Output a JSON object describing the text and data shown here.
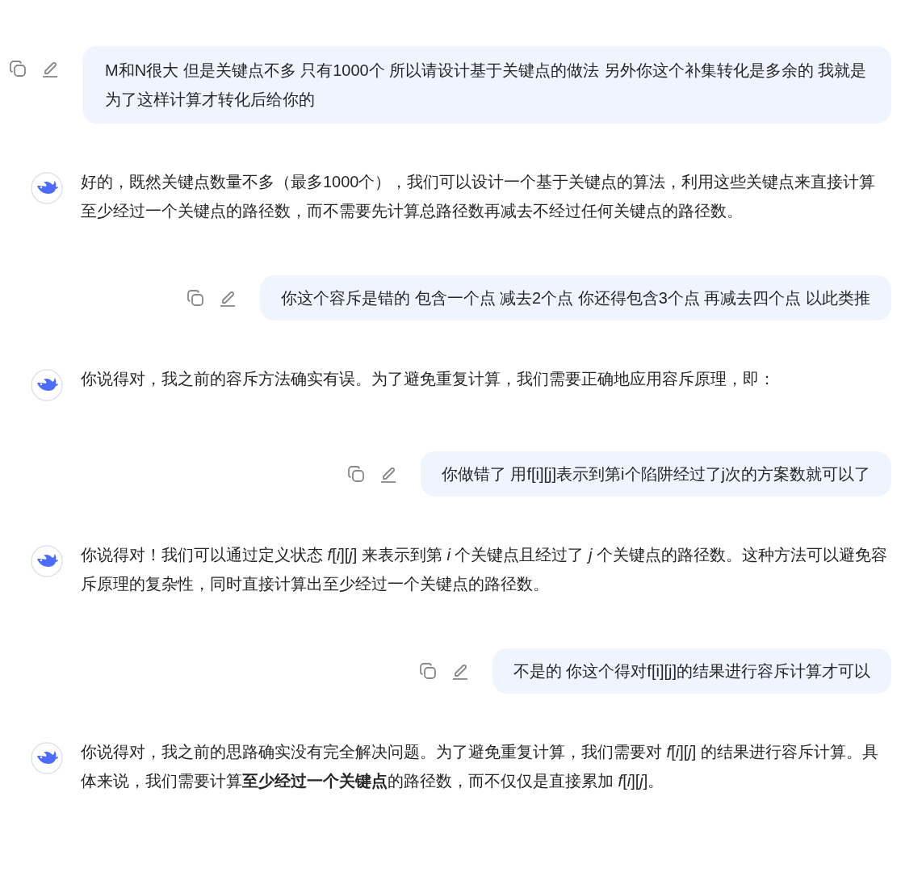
{
  "messages": [
    {
      "kind": "user",
      "text": "M和N很大 但是关键点不多  只有1000个 所以请设计基于关键点的做法 另外你这个补集转化是多余的 我就是为了这样计算才转化后给你的"
    },
    {
      "kind": "assistant",
      "text": "好的，既然关键点数量不多（最多1000个），我们可以设计一个基于关键点的算法，利用这些关键点来直接计算至少经过一个关键点的路径数，而不需要先计算总路径数再减去不经过任何关键点的路径数。"
    },
    {
      "kind": "user",
      "text": "你这个容斥是错的 包含一个点 减去2个点 你还得包含3个点 再减去四个点 以此类推"
    },
    {
      "kind": "assistant",
      "text": "你说得对，我之前的容斥方法确实有误。为了避免重复计算，我们需要正确地应用容斥原理，即："
    },
    {
      "kind": "user",
      "text": "你做错了 用f[i][j]表示到第i个陷阱经过了j次的方案数就可以了"
    },
    {
      "kind": "assistant",
      "text": "你说得对！我们可以通过定义状态 *f*[*i*][*j*] 来表示到第 *i* 个关键点且经过了 *j* 个关键点的路径数。这种方法可以避免容斥原理的复杂性，同时直接计算出至少经过一个关键点的路径数。"
    },
    {
      "kind": "user",
      "text": "不是的 你这个得对f[i][j]的结果进行容斥计算才可以"
    },
    {
      "kind": "assistant",
      "text": "你说得对，我之前的思路确实没有完全解决问题。为了避免重复计算，我们需要对 *f*[*i*][*j*] 的结果进行容斥计算。具体来说，我们需要计算**至少经过一个关键点**的路径数，而不仅仅是直接累加 *f*[*i*][*j*]。"
    }
  ]
}
